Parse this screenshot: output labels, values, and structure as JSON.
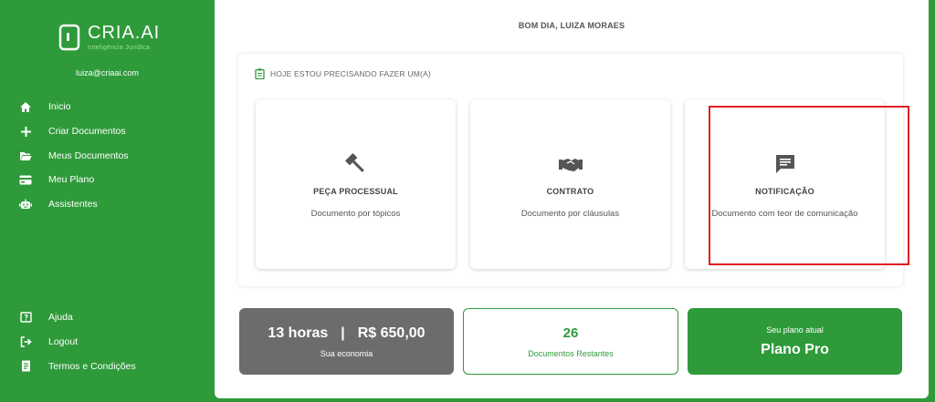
{
  "brand": {
    "name": "CRIA.AI",
    "tagline": "Inteligência Jurídica",
    "accent": "#2e9a3a"
  },
  "user": {
    "email": "luiza@criaai.com"
  },
  "sidebar": {
    "items": [
      {
        "label": "Inicio",
        "icon": "home-icon"
      },
      {
        "label": "Criar Documentos",
        "icon": "plus-icon"
      },
      {
        "label": "Meus Documentos",
        "icon": "folder-icon"
      },
      {
        "label": "Meu Plano",
        "icon": "credit-card-icon"
      },
      {
        "label": "Assistentes",
        "icon": "robot-icon"
      }
    ],
    "bottom_items": [
      {
        "label": "Ajuda",
        "icon": "help-icon"
      },
      {
        "label": "Logout",
        "icon": "logout-icon"
      },
      {
        "label": "Termos e Condições",
        "icon": "document-icon"
      }
    ]
  },
  "main": {
    "greeting": "BOM DIA, LUIZA MORAES",
    "prompt": "HOJE ESTOU PRECISANDO FAZER UM(A)",
    "cards": [
      {
        "title": "PEÇA PROCESSUAL",
        "desc": "Documento por tópicos",
        "icon": "gavel-icon"
      },
      {
        "title": "CONTRATO",
        "desc": "Documento por cláusulas",
        "icon": "handshake-icon"
      },
      {
        "title": "NOTIFICAÇÃO",
        "desc": "Documento com teor de comunicação",
        "icon": "message-icon"
      }
    ],
    "highlight_color": "#e02020"
  },
  "stats": {
    "economy_hours": "13 horas",
    "economy_separator": "|",
    "economy_value": "R$ 650,00",
    "economy_label": "Sua economia",
    "documents_count": "26",
    "documents_label": "Documentos Restantes",
    "plan_label": "Seu plano atual",
    "plan_name": "Plano Pro"
  }
}
